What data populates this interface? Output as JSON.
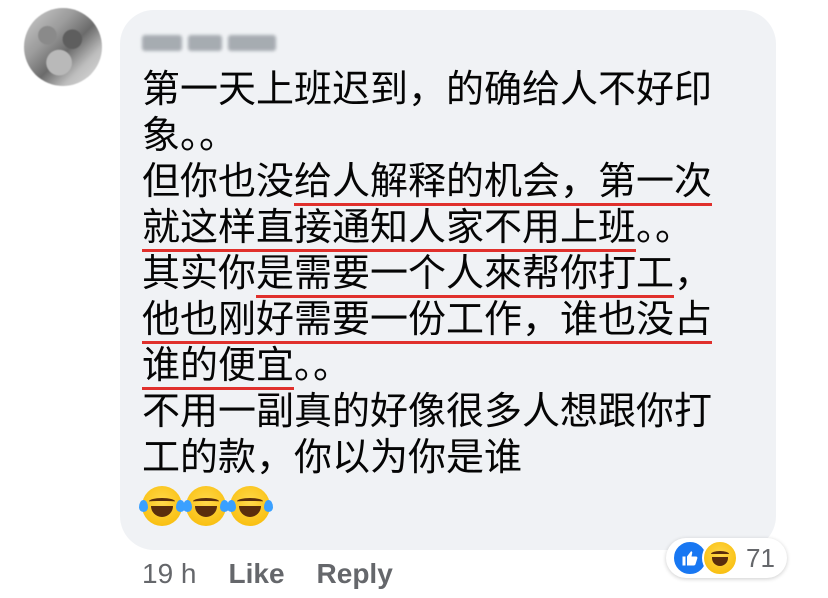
{
  "comment": {
    "lines": [
      "第一天上班迟到，的确给人不好印",
      "象。。",
      "但你也没给人解释的机会，第一次",
      "就这样直接通知人家不用上班。。",
      "其实你是需要一个人來帮你打工，",
      "他也刚好需要一份工作，谁也没占",
      "谁的便宜。。",
      "不用一副真的好像很多人想跟你打",
      "工的款，你以为你是谁"
    ],
    "emojis": [
      "laughing-tears",
      "laughing-tears",
      "laughing-tears"
    ]
  },
  "meta": {
    "time": "19 h",
    "like_label": "Like",
    "reply_label": "Reply"
  },
  "reactions": {
    "icons": [
      "like-icon",
      "haha-icon"
    ],
    "count": "71",
    "like_color": "#1877f2"
  },
  "colors": {
    "bubble": "#f0f2f5",
    "underline": "#e0302c",
    "meta_text": "#65676b"
  }
}
